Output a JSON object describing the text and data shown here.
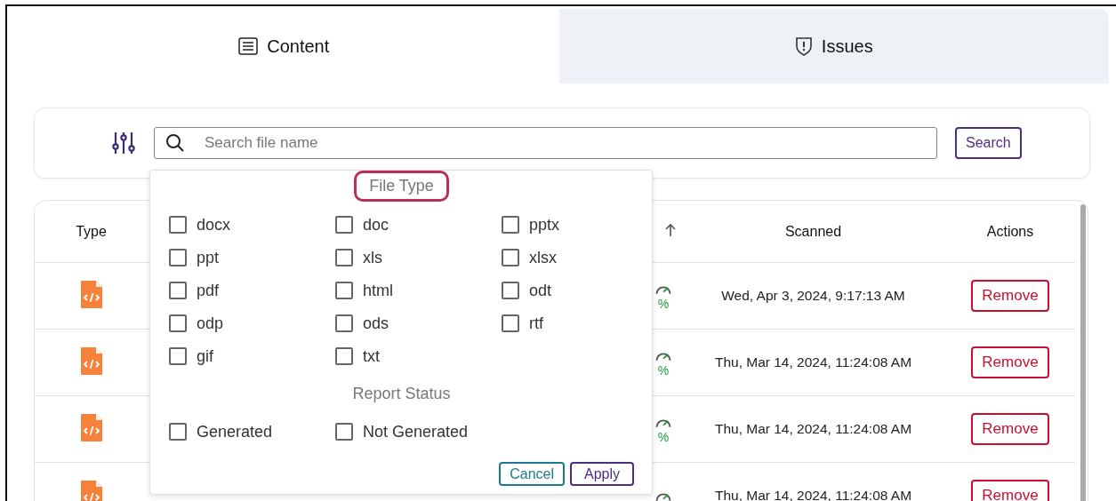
{
  "tabs": [
    {
      "label": "Content",
      "selected": true
    },
    {
      "label": "Issues",
      "selected": false
    }
  ],
  "search": {
    "placeholder": "Search file name",
    "button": "Search"
  },
  "table": {
    "columns": [
      "Type",
      "Scanned",
      "Actions"
    ],
    "rows": [
      {
        "score": "%",
        "scanned": "Wed, Apr 3, 2024, 9:17:13 AM",
        "action": "Remove"
      },
      {
        "score": "%",
        "scanned": "Thu, Mar 14, 2024, 11:24:08 AM",
        "action": "Remove"
      },
      {
        "score": "%",
        "scanned": "Thu, Mar 14, 2024, 11:24:08 AM",
        "action": "Remove"
      },
      {
        "score": "",
        "scanned": "Thu, Mar 14, 2024, 11:24:08 AM",
        "action": "Remove"
      }
    ]
  },
  "filter_popup": {
    "file_type_title": "File Type",
    "file_types": [
      {
        "label": "docx",
        "checked": false
      },
      {
        "label": "doc",
        "checked": false
      },
      {
        "label": "pptx",
        "checked": false
      },
      {
        "label": "ppt",
        "checked": false
      },
      {
        "label": "xls",
        "checked": false
      },
      {
        "label": "xlsx",
        "checked": false
      },
      {
        "label": "pdf",
        "checked": false
      },
      {
        "label": "html",
        "checked": false
      },
      {
        "label": "odt",
        "checked": false
      },
      {
        "label": "odp",
        "checked": false
      },
      {
        "label": "ods",
        "checked": false
      },
      {
        "label": "rtf",
        "checked": false
      },
      {
        "label": "gif",
        "checked": false
      },
      {
        "label": "txt",
        "checked": false
      }
    ],
    "report_status_title": "Report Status",
    "report_statuses": [
      {
        "label": "Generated",
        "checked": false
      },
      {
        "label": "Not Generated",
        "checked": false
      }
    ],
    "cancel": "Cancel",
    "apply": "Apply"
  }
}
